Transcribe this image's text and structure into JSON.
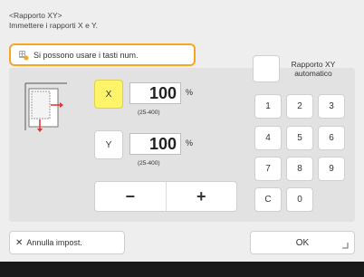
{
  "header": {
    "title": "<Rapporto XY>",
    "subtitle": "Immettere i rapporti X e Y."
  },
  "hint": {
    "text": "Si possono usare i tasti num."
  },
  "x_axis": {
    "label": "X",
    "value": "100",
    "unit": "%",
    "range": "(25-400)"
  },
  "y_axis": {
    "label": "Y",
    "value": "100",
    "unit": "%",
    "range": "(25-400)"
  },
  "stepper": {
    "minus": "−",
    "plus": "+"
  },
  "auto_ratio": {
    "label_line1": "Rapporto XY",
    "label_line2": "automatico"
  },
  "keypad": {
    "keys": [
      "1",
      "2",
      "3",
      "4",
      "5",
      "6",
      "7",
      "8",
      "9",
      "C",
      "0"
    ]
  },
  "footer": {
    "cancel": "Annulla impost.",
    "ok": "OK"
  },
  "colors": {
    "accent_yellow": "#fff46a",
    "hint_border": "#f5a623"
  }
}
